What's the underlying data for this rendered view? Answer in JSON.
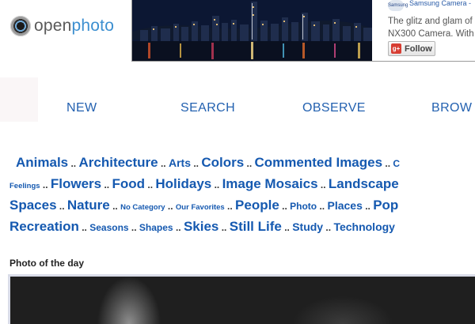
{
  "header": {
    "logo_open": "open",
    "logo_photo": "photo",
    "logo_icon": "camera-lens-icon"
  },
  "ad": {
    "brand_logo_text": "Samsung",
    "brand_name": "Samsung Camera -",
    "description_line1": "The glitz and glam of",
    "description_line2": "NX300 Camera. With",
    "follow_label": "Follow",
    "follow_icon": "gplus-icon"
  },
  "nav": {
    "items": [
      "NEW",
      "SEARCH",
      "OBSERVE",
      "BROW"
    ]
  },
  "categories": {
    "row1": [
      "Animals",
      "Architecture",
      "Arts",
      "Colors",
      "Commented Images",
      "C"
    ],
    "row2": [
      "Feelings",
      "Flowers",
      "Food",
      "Holidays",
      "Image Mosaics",
      "Landscape"
    ],
    "row3": [
      "Spaces",
      "Nature",
      "No Category",
      "Our Favorites",
      "People",
      "Photo",
      "Places",
      "Pop"
    ],
    "row4": [
      "Recreation",
      "Seasons",
      "Shapes",
      "Skies",
      "Still Life",
      "Study",
      "Technology"
    ],
    "separator": ".."
  },
  "photo_of_day": {
    "title": "Photo of the day"
  },
  "colors": {
    "link_blue": "#1559b0",
    "nav_blue": "#2361b0",
    "logo_blue": "#3c8fd0"
  }
}
